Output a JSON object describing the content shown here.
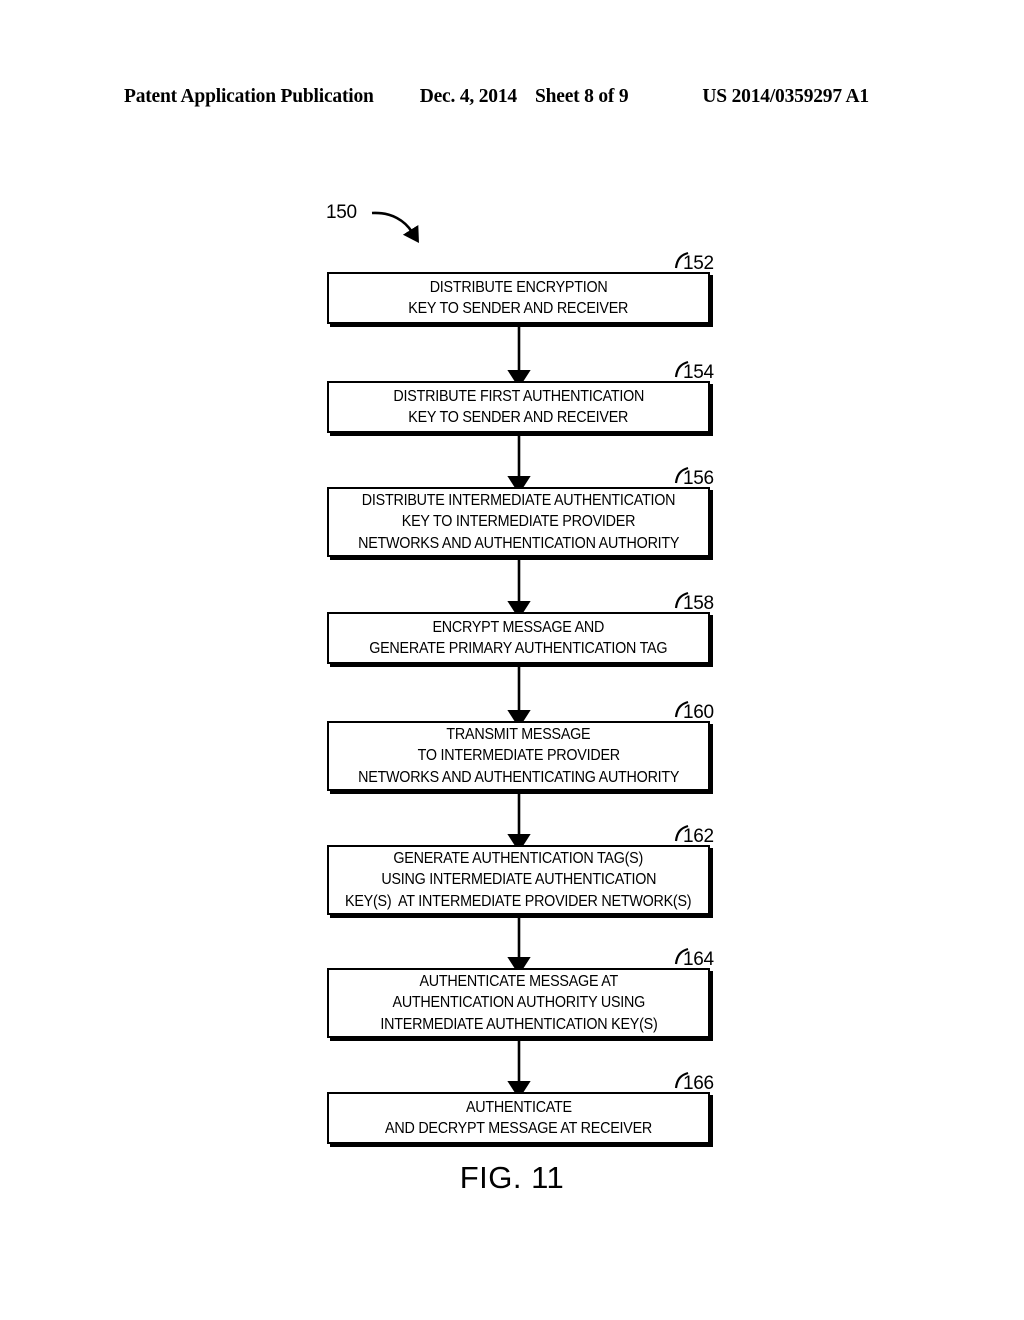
{
  "header": {
    "publication": "Patent Application Publication",
    "date": "Dec. 4, 2014",
    "sheet": "Sheet 8 of 9",
    "patent_number": "US 2014/0359297 A1"
  },
  "figure": {
    "caption": "FIG. 11",
    "diagram_label": "150",
    "type": "flowchart",
    "steps": [
      {
        "ref": "152",
        "lines": [
          "DISTRIBUTE ENCRYPTION",
          "KEY TO SENDER AND RECEIVER"
        ]
      },
      {
        "ref": "154",
        "lines": [
          "DISTRIBUTE FIRST AUTHENTICATION",
          "KEY TO SENDER AND RECEIVER"
        ]
      },
      {
        "ref": "156",
        "lines": [
          "DISTRIBUTE INTERMEDIATE AUTHENTICATION",
          "KEY TO INTERMEDIATE PROVIDER",
          "NETWORKS AND AUTHENTICATION AUTHORITY"
        ]
      },
      {
        "ref": "158",
        "lines": [
          "ENCRYPT MESSAGE AND",
          "GENERATE PRIMARY AUTHENTICATION TAG"
        ]
      },
      {
        "ref": "160",
        "lines": [
          "TRANSMIT MESSAGE",
          "TO INTERMEDIATE PROVIDER",
          "NETWORKS AND AUTHENTICATING AUTHORITY"
        ]
      },
      {
        "ref": "162",
        "lines": [
          "GENERATE AUTHENTICATION TAG(S)",
          "USING INTERMEDIATE AUTHENTICATION",
          "KEY(S)  AT INTERMEDIATE PROVIDER NETWORK(S)"
        ]
      },
      {
        "ref": "164",
        "lines": [
          "AUTHENTICATE MESSAGE AT",
          "AUTHENTICATION AUTHORITY USING",
          "INTERMEDIATE AUTHENTICATION KEY(S)"
        ]
      },
      {
        "ref": "166",
        "lines": [
          "AUTHENTICATE",
          "AND DECRYPT MESSAGE AT RECEIVER"
        ]
      }
    ],
    "connectors": "sequential downward arrows between each consecutive step"
  },
  "colors": {
    "ink": "#000000",
    "paper": "#ffffff"
  }
}
